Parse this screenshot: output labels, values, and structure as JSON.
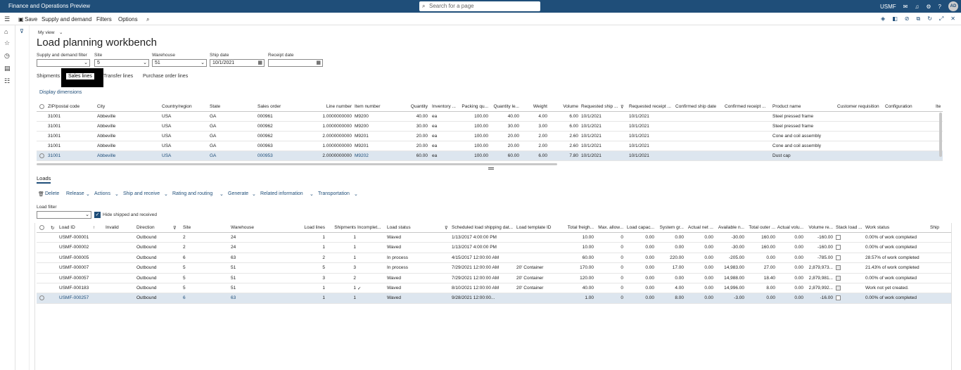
{
  "topbar": {
    "app_title": "Finance and Operations Preview",
    "search_placeholder": "Search for a page",
    "company": "USMF",
    "avatar": "AD"
  },
  "actionbar": {
    "save": "Save",
    "supply_demand": "Supply and demand",
    "filters": "Filters",
    "options": "Options"
  },
  "page": {
    "view": "My view",
    "title": "Load planning workbench"
  },
  "filters": {
    "sd_filter_label": "Supply and demand filter",
    "sd_filter_value": "",
    "site_label": "Site",
    "site_value": "5",
    "warehouse_label": "Warehouse",
    "warehouse_value": "51",
    "shipdate_label": "Ship date",
    "shipdate_value": "10/1/2021",
    "receiptdate_label": "Receipt date",
    "receiptdate_value": ""
  },
  "tabs": {
    "shipments": "Shipments",
    "sales_lines": "Sales lines",
    "transfer_lines": "Transfer lines",
    "purchase_lines": "Purchase order lines"
  },
  "display_dimensions": "Display dimensions",
  "sales_grid": {
    "headers": [
      "ZIP/postal code",
      "City",
      "Country/region",
      "State",
      "Sales order",
      "Line number",
      "Item number",
      "Quantity",
      "Inventory ...",
      "Packing qu...",
      "Quantity le...",
      "Weight",
      "Volume",
      "Requested ship ...",
      "Requested receipt ...",
      "Confirmed ship date",
      "Confirmed receipt ...",
      "Product name",
      "Customer requisition",
      "Configuration",
      "Ite"
    ],
    "rows": [
      [
        "31001",
        "Abbeville",
        "USA",
        "GA",
        "000961",
        "1.0000000000",
        "M9200",
        "40.00",
        "ea",
        "100.00",
        "40.00",
        "4.00",
        "6.00",
        "10/1/2021",
        "10/1/2021",
        "",
        "",
        "Steel pressed frame",
        "",
        "",
        ""
      ],
      [
        "31001",
        "Abbeville",
        "USA",
        "GA",
        "000962",
        "1.0000000000",
        "M9200",
        "30.00",
        "ea",
        "100.00",
        "30.00",
        "3.00",
        "6.00",
        "10/1/2021",
        "10/1/2021",
        "",
        "",
        "Steel pressed frame",
        "",
        "",
        ""
      ],
      [
        "31001",
        "Abbeville",
        "USA",
        "GA",
        "000962",
        "2.0000000000",
        "M9201",
        "20.00",
        "ea",
        "100.00",
        "20.00",
        "2.00",
        "2.60",
        "10/1/2021",
        "10/1/2021",
        "",
        "",
        "Cone and coil assembly",
        "",
        "",
        ""
      ],
      [
        "31001",
        "Abbeville",
        "USA",
        "GA",
        "000963",
        "1.0000000000",
        "M9201",
        "20.00",
        "ea",
        "100.00",
        "20.00",
        "2.00",
        "2.60",
        "10/1/2021",
        "10/1/2021",
        "",
        "",
        "Cone and coil assembly",
        "",
        "",
        ""
      ],
      [
        "31001",
        "Abbeville",
        "USA",
        "GA",
        "000953",
        "2.0000000000",
        "M9202",
        "60.00",
        "ea",
        "100.00",
        "60.00",
        "6.00",
        "7.80",
        "10/1/2021",
        "10/1/2021",
        "",
        "",
        "Dust cap",
        "",
        "",
        ""
      ]
    ]
  },
  "loads": {
    "section_title": "Loads",
    "menu": {
      "delete": "Delete",
      "release": "Release",
      "actions": "Actions",
      "ship_receive": "Ship and receive",
      "rating": "Rating and routing",
      "generate": "Generate",
      "related": "Related information",
      "transportation": "Transportation"
    },
    "load_filter_label": "Load filter",
    "load_filter_value": "",
    "hide_shipped": "Hide shipped and received",
    "headers": [
      "Load ID",
      "Invalid",
      "Direction",
      "Site",
      "Warehouse",
      "Load lines",
      "Shipments",
      "Incomplet...",
      "Load status",
      "Scheduled load shipping dat...",
      "Load template ID",
      "Total freigh...",
      "Max. allow...",
      "Load capac...",
      "System gr...",
      "Actual net ...",
      "Available n...",
      "Total outer ...",
      "Actual volu...",
      "Volume re...",
      "Stack load ...",
      "Work status",
      "Ship"
    ],
    "rows": [
      [
        "USMF-000001",
        "",
        "Outbound",
        "2",
        "24",
        "1",
        "1",
        "",
        "Waved",
        "1/13/2017 4:00:00 PM",
        "",
        "10.00",
        "0",
        "0.00",
        "0.00",
        "0.00",
        "-30.00",
        "160.00",
        "0.00",
        "-160.00",
        "",
        "0.00% of work completed",
        ""
      ],
      [
        "USMF-000002",
        "",
        "Outbound",
        "2",
        "24",
        "1",
        "1",
        "",
        "Waved",
        "1/13/2017 4:00:00 PM",
        "",
        "10.00",
        "0",
        "0.00",
        "0.00",
        "0.00",
        "-30.00",
        "160.00",
        "0.00",
        "-160.00",
        "",
        "0.00% of work completed",
        ""
      ],
      [
        "USMF-000005",
        "",
        "Outbound",
        "6",
        "63",
        "2",
        "1",
        "",
        "In process",
        "4/15/2017 12:00:00 AM",
        "",
        "60.00",
        "0",
        "0.00",
        "220.00",
        "0.00",
        "-205.00",
        "0.00",
        "0.00",
        "-785.00",
        "",
        "28.57% of work completed",
        ""
      ],
      [
        "USMF-000007",
        "",
        "Outbound",
        "5",
        "51",
        "5",
        "3",
        "",
        "In process",
        "7/29/2021 12:00:00 AM",
        "20' Container",
        "170.00",
        "0",
        "0.00",
        "17.00",
        "0.00",
        "14,983.00",
        "27.00",
        "0.00",
        "2,879,973...",
        "",
        "21.43% of work completed",
        ""
      ],
      [
        "USMF-000057",
        "",
        "Outbound",
        "5",
        "51",
        "3",
        "2",
        "",
        "Waved",
        "7/29/2021 12:00:00 AM",
        "20' Container",
        "120.00",
        "0",
        "0.00",
        "0.00",
        "0.00",
        "14,988.00",
        "18.40",
        "0.00",
        "2,879,981...",
        "",
        "0.00% of work completed",
        ""
      ],
      [
        "USMF-000183",
        "",
        "Outbound",
        "5",
        "51",
        "1",
        "1",
        "✓",
        "Waved",
        "8/10/2021 12:00:00 AM",
        "20' Container",
        "40.00",
        "0",
        "0.00",
        "4.00",
        "0.00",
        "14,996.00",
        "8.00",
        "0.00",
        "2,879,992...",
        "",
        "Work not yet created.",
        ""
      ],
      [
        "USMF-000257",
        "",
        "Outbound",
        "6",
        "63",
        "1",
        "1",
        "",
        "Waved",
        "9/28/2021 12:00:00...",
        "",
        "1.00",
        "0",
        "0.00",
        "8.00",
        "0.00",
        "-3.00",
        "0.00",
        "0.00",
        "-16.00",
        "",
        "0.00% of work completed",
        ""
      ]
    ]
  }
}
